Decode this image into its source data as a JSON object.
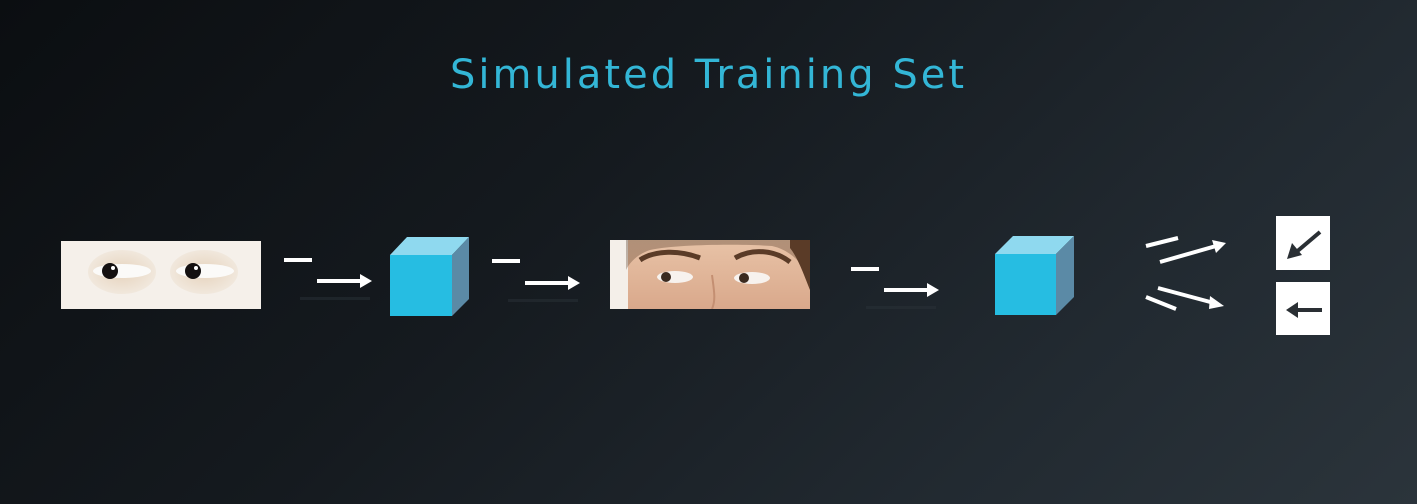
{
  "title": "Simulated Training Set",
  "colors": {
    "title": "#33b6d6",
    "cube_front": "#26bde2",
    "cube_top": "#8fd9ef",
    "cube_side": "#5b8aa6",
    "arrow": "#ffffff",
    "output_box": "#ffffff",
    "output_arrow": "#2a2f34"
  },
  "pipeline": [
    {
      "kind": "image",
      "name": "simulated-eyes-image",
      "description_icon": "eyes-render-icon"
    },
    {
      "kind": "flow-arrow",
      "name": "flow-arrow-1"
    },
    {
      "kind": "cube",
      "name": "refiner-cube"
    },
    {
      "kind": "flow-arrow",
      "name": "flow-arrow-2"
    },
    {
      "kind": "image",
      "name": "refined-face-image",
      "description_icon": "face-photo-icon"
    },
    {
      "kind": "flow-arrow",
      "name": "flow-arrow-3"
    },
    {
      "kind": "cube",
      "name": "estimator-cube"
    },
    {
      "kind": "split-arrows",
      "name": "split-arrows"
    },
    {
      "kind": "outputs",
      "name": "gaze-outputs",
      "icons": [
        "arrow-down-left-icon",
        "arrow-left-icon"
      ]
    }
  ]
}
